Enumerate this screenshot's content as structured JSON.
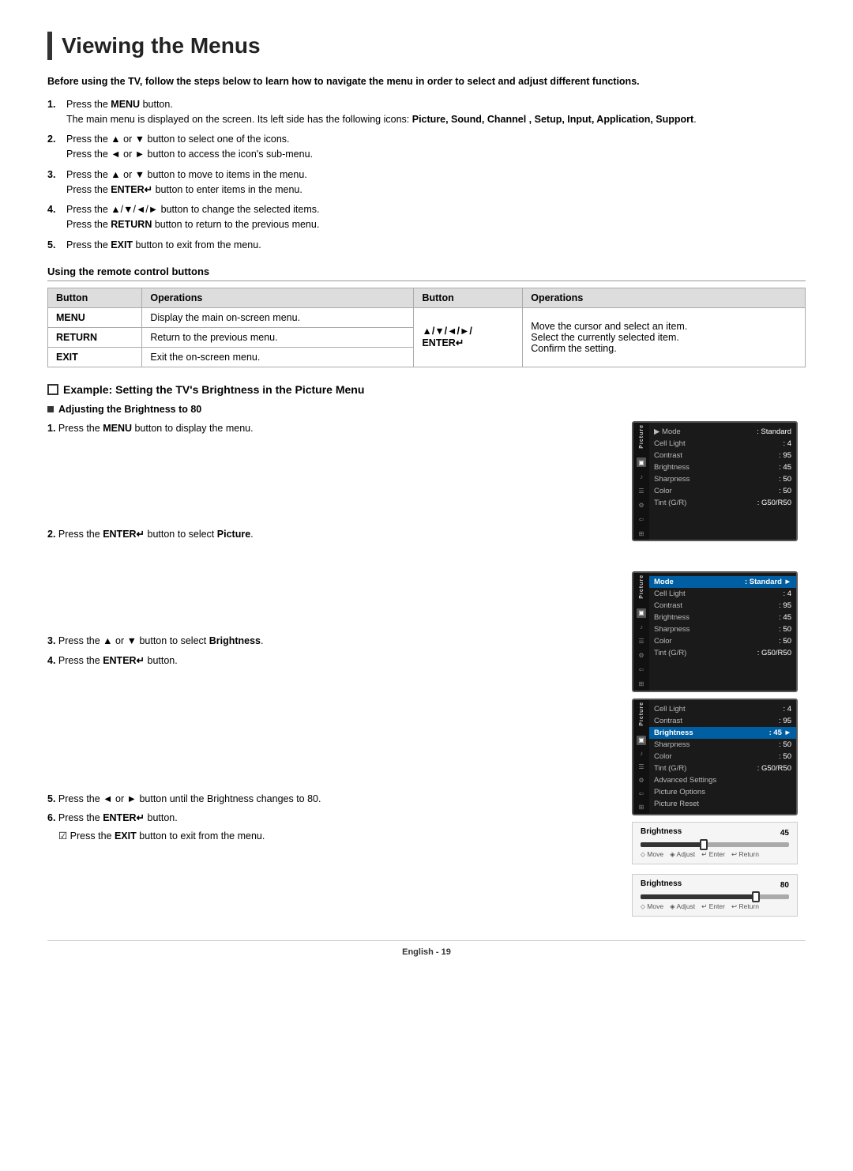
{
  "page": {
    "title": "Viewing the Menus",
    "footer": "English - 19"
  },
  "intro": {
    "bold_text": "Before using the TV, follow the steps below to learn how to navigate the menu in order to select and adjust different functions.",
    "steps": [
      {
        "num": "1.",
        "text": "Press the ",
        "bold": "MENU",
        "rest": " button.",
        "sub": "The main menu is displayed on the screen. Its left side has the following icons: ",
        "sub_bold": "Picture, Sound, Channel , Setup, Input, Application, Support",
        "sub_end": "."
      },
      {
        "num": "2.",
        "text": "Press the ▲ or ▼ button to select one of the icons.",
        "sub": "Press the ◄ or ► button to access the icon's sub-menu."
      },
      {
        "num": "3.",
        "text": "Press the ▲ or ▼ button to move to items in the menu.",
        "sub": "Press the ENTER↵ button to enter items in the menu."
      },
      {
        "num": "4.",
        "text": "Press the ▲/▼/◄/► button to change the selected items.",
        "sub": "Press the RETURN button to return to the previous menu."
      },
      {
        "num": "5.",
        "text": "Press the EXIT button to exit from the menu."
      }
    ]
  },
  "remote_table": {
    "heading": "Using the remote control buttons",
    "col1_header": "Button",
    "col2_header": "Operations",
    "col3_header": "Button",
    "col4_header": "Operations",
    "rows": [
      {
        "button": "MENU",
        "operation": "Display the main on-screen menu.",
        "button2": "▲/▼/◄/►/\nENTER↵",
        "operation2": "Move the cursor and select an item.\nSelect the currently selected item.\nConfirm the setting."
      },
      {
        "button": "RETURN",
        "operation": "Return to the previous menu.",
        "button2": "",
        "operation2": ""
      },
      {
        "button": "EXIT",
        "operation": "Exit the on-screen menu.",
        "button2": "",
        "operation2": ""
      }
    ]
  },
  "example": {
    "heading": "Example: Setting the TV's Brightness in the Picture Menu",
    "sub_heading": "Adjusting the Brightness to 80",
    "steps": [
      {
        "num": "1.",
        "text": "Press the ",
        "bold": "MENU",
        "rest": " button to display the menu."
      },
      {
        "num": "2.",
        "text": "Press the ",
        "bold": "ENTER↵",
        "rest": " button to select ",
        "bold2": "Picture",
        "end": "."
      },
      {
        "num": "3.",
        "text": "Press the ▲ or ▼ button to select ",
        "bold": "Brightness",
        "end": "."
      },
      {
        "num": "4.",
        "text": "Press the ",
        "bold": "ENTER↵",
        "rest": " button.",
        "end": ""
      },
      {
        "num": "5.",
        "text": "Press the ◄ or ► button until the Brightness changes to 80."
      },
      {
        "num": "6.",
        "text": "Press the ",
        "bold": "ENTER↵",
        "rest": " button.",
        "note": "Press the EXIT button to exit from the menu."
      }
    ]
  },
  "tv_menus": [
    {
      "id": "menu1",
      "sidebar_label": "Picture",
      "rows": [
        {
          "label": "▶ Mode",
          "value": ": Standard",
          "highlighted": false
        },
        {
          "label": "Cell Light",
          "value": ": 4",
          "highlighted": false
        },
        {
          "label": "Contrast",
          "value": ": 95",
          "highlighted": false
        },
        {
          "label": "Brightness",
          "value": ": 45",
          "highlighted": false
        },
        {
          "label": "Sharpness",
          "value": ": 50",
          "highlighted": false
        },
        {
          "label": "Color",
          "value": ": 50",
          "highlighted": false
        },
        {
          "label": "Tint (G/R)",
          "value": ": G50/R50",
          "highlighted": false
        }
      ]
    },
    {
      "id": "menu2",
      "sidebar_label": "Picture",
      "rows": [
        {
          "label": "Mode",
          "value": ": Standard ►",
          "highlighted": true
        },
        {
          "label": "Cell Light",
          "value": ": 4",
          "highlighted": false
        },
        {
          "label": "Contrast",
          "value": ": 95",
          "highlighted": false
        },
        {
          "label": "Brightness",
          "value": ": 45",
          "highlighted": false
        },
        {
          "label": "Sharpness",
          "value": ": 50",
          "highlighted": false
        },
        {
          "label": "Color",
          "value": ": 50",
          "highlighted": false
        },
        {
          "label": "Tint (G/R)",
          "value": ": G50/R50",
          "highlighted": false
        }
      ]
    },
    {
      "id": "menu3",
      "sidebar_label": "Picture",
      "rows": [
        {
          "label": "Cell Light",
          "value": ": 4",
          "highlighted": false
        },
        {
          "label": "Contrast",
          "value": ": 95",
          "highlighted": false
        },
        {
          "label": "Brightness",
          "value": ": 45 ►",
          "highlighted": true
        },
        {
          "label": "Sharpness",
          "value": ": 50",
          "highlighted": false
        },
        {
          "label": "Color",
          "value": ": 50",
          "highlighted": false
        },
        {
          "label": "Tint (G/R)",
          "value": ": G50/R50",
          "highlighted": false
        },
        {
          "label": "Advanced Settings",
          "value": "",
          "highlighted": false
        },
        {
          "label": "Picture Options",
          "value": "",
          "highlighted": false
        },
        {
          "label": "Picture Reset",
          "value": "",
          "highlighted": false
        }
      ]
    }
  ],
  "sliders": [
    {
      "label": "Brightness",
      "value": 45,
      "value_display": "45",
      "fill_percent": 45,
      "thumb_percent": 43
    },
    {
      "label": "Brightness",
      "value": 80,
      "value_display": "80",
      "fill_percent": 80,
      "thumb_percent": 78
    }
  ],
  "slider_controls": {
    "move": "Move",
    "adjust": "Adjust",
    "enter": "Enter",
    "return": "Return"
  }
}
